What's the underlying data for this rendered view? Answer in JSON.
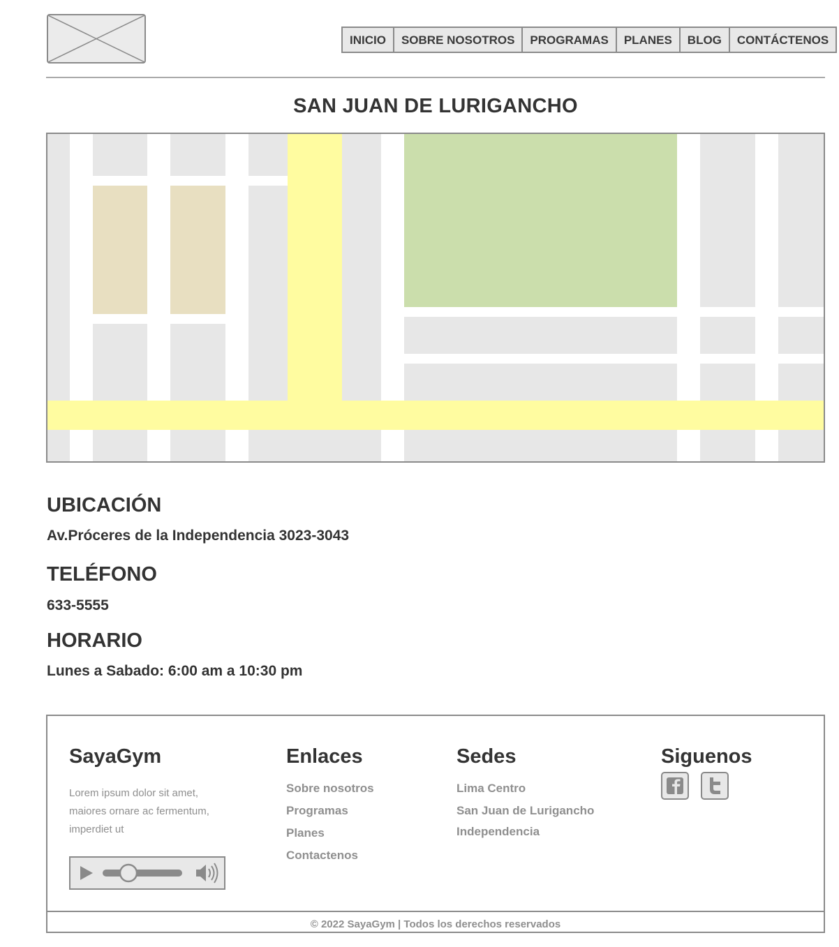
{
  "nav": {
    "items": [
      "INICIO",
      "SOBRE NOSOTROS",
      "PROGRAMAS",
      "PLANES",
      "BLOG",
      "CONTÁCTENOS"
    ]
  },
  "page": {
    "title": "SAN JUAN DE LURIGANCHO"
  },
  "info": {
    "location_heading": "UBICACIÓN",
    "location_value": "Av.Próceres de la Independencia 3023-3043",
    "phone_heading": "TELÉFONO",
    "phone_value": "633-5555",
    "hours_heading": "HORARIO",
    "hours_value": "Lunes a Sabado: 6:00 am a 10:30 pm"
  },
  "footer": {
    "brand": "SayaGym",
    "about": "Lorem ipsum dolor sit amet, maiores ornare ac fermentum, imperdiet ut",
    "links_title": "Enlaces",
    "links": [
      "Sobre nosotros",
      "Programas",
      "Planes",
      "Contactenos"
    ],
    "locations_title": "Sedes",
    "locations": [
      "Lima Centro",
      "San Juan de Lurigancho",
      "Independencia"
    ],
    "social_title": "Siguenos",
    "social_icons": [
      "facebook-icon",
      "twitter-icon"
    ],
    "copyright": "© 2022 SayaGym | Todos los derechos reservados"
  },
  "colors": {
    "map_block": "#e7e7e7",
    "map_road": "#ffffff",
    "map_highway": "#fffca0",
    "map_park": "#cbdeac",
    "map_building": "#e8dfc1",
    "border": "#8a8a8a"
  }
}
